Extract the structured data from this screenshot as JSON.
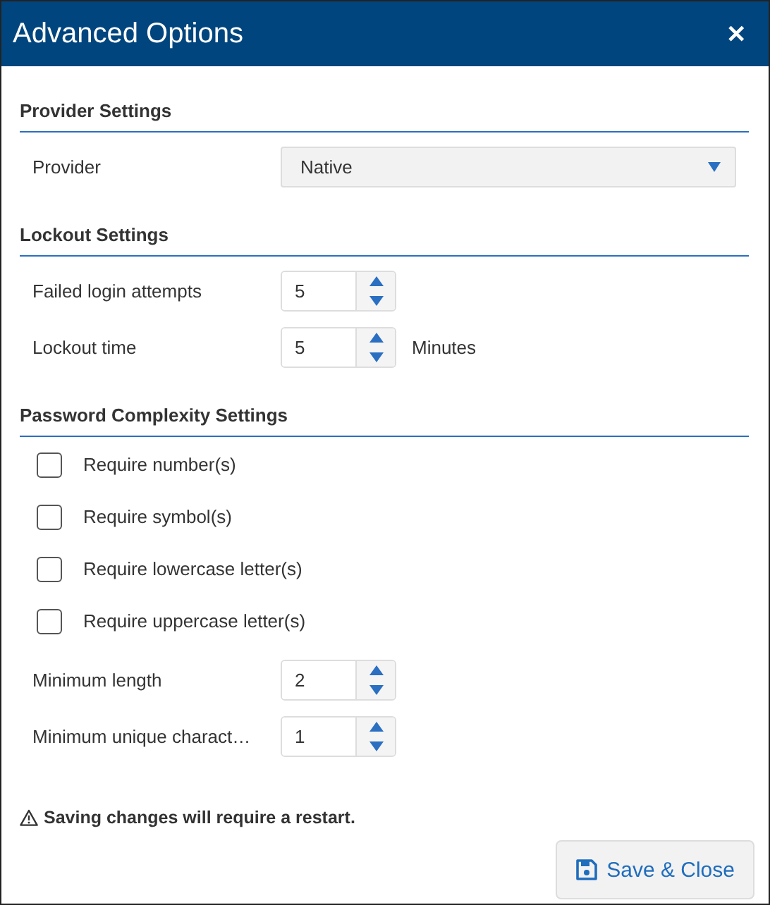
{
  "window": {
    "title": "Advanced Options",
    "close": "✕"
  },
  "sections": [
    {
      "title": "Provider Settings",
      "items": [
        {
          "kind": "select",
          "label": "Provider",
          "value": "Native"
        }
      ]
    },
    {
      "title": "Lockout Settings",
      "items": [
        {
          "kind": "number",
          "label": "Failed login attempts",
          "value": "5"
        },
        {
          "kind": "number",
          "label": "Lockout time",
          "value": "5",
          "unit": "Minutes"
        }
      ]
    },
    {
      "title": "Password Complexity Settings",
      "items": [
        {
          "kind": "checkbox",
          "label": "Require number(s)",
          "checked": false
        },
        {
          "kind": "checkbox",
          "label": "Require symbol(s)",
          "checked": false
        },
        {
          "kind": "checkbox",
          "label": "Require lowercase letter(s)",
          "checked": false
        },
        {
          "kind": "checkbox",
          "label": "Require uppercase letter(s)",
          "checked": false
        },
        {
          "kind": "number",
          "label": "Minimum length",
          "value": "2"
        },
        {
          "kind": "number",
          "label": "Minimum unique charact…",
          "value": "1"
        }
      ]
    }
  ],
  "warning": "Saving changes will require a restart.",
  "save_button": "Save & Close"
}
